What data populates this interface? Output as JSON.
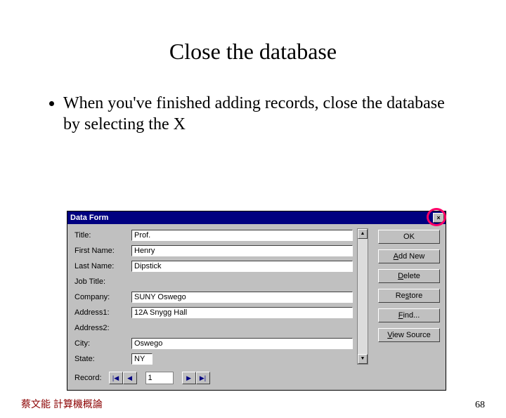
{
  "title": "Close the database",
  "bullet": "When you've finished adding records, close the database by selecting the X",
  "window": {
    "caption": "Data Form",
    "close_glyph": "×",
    "labels": {
      "title": "Title:",
      "first": "First Name:",
      "last": "Last Name:",
      "job": "Job Title:",
      "company": "Company:",
      "addr1": "Address1:",
      "addr2": "Address2:",
      "city": "City:",
      "state": "State:"
    },
    "values": {
      "title": "Prof.",
      "first": "Henry",
      "last": "Dipstick",
      "job": "",
      "company": "SUNY Oswego",
      "addr1": "12A Snygg Hall",
      "addr2": "",
      "city": "Oswego",
      "state": "NY"
    },
    "buttons": {
      "ok": "OK",
      "add": "Add New",
      "del": "Delete",
      "restore": "Restore",
      "find": "Find...",
      "view": "View Source"
    },
    "record_label": "Record:",
    "record_value": "1",
    "scroll_up": "▲",
    "scroll_down": "▼",
    "nav_first": "|◀",
    "nav_prev": "◀",
    "nav_next": "▶",
    "nav_last": "▶|"
  },
  "footer_left": "蔡文能 計算機概論",
  "page_number": "68"
}
